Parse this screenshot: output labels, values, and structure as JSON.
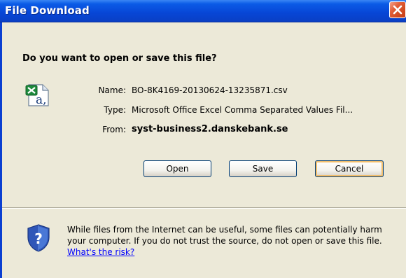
{
  "window": {
    "title": "File Download"
  },
  "dialog": {
    "question": "Do you want to open or save this file?",
    "name_label": "Name:",
    "name_value": "BO-8K4169-20130624-13235871.csv",
    "type_label": "Type:",
    "type_value": "Microsoft Office Excel Comma Separated Values Fil...",
    "from_label": "From:",
    "from_value": "syst-business2.danskebank.se"
  },
  "buttons": {
    "open_label": "Open",
    "save_label": "Save",
    "cancel_label": "Cancel"
  },
  "warning": {
    "text": "While files from the Internet can be useful, some files can potentially harm your computer. If you do not trust the source, do not open or save this file.",
    "link_text": "What's the risk?"
  },
  "icons": {
    "file": "excel-csv-file-icon",
    "warning": "security-shield-icon",
    "close": "close-icon"
  },
  "colors": {
    "titlebar": "#0b5be6",
    "close_button": "#d14a21",
    "dialog_background": "#ece9d8",
    "link": "#0000ff",
    "default_button_highlight": "#f1be6d"
  }
}
